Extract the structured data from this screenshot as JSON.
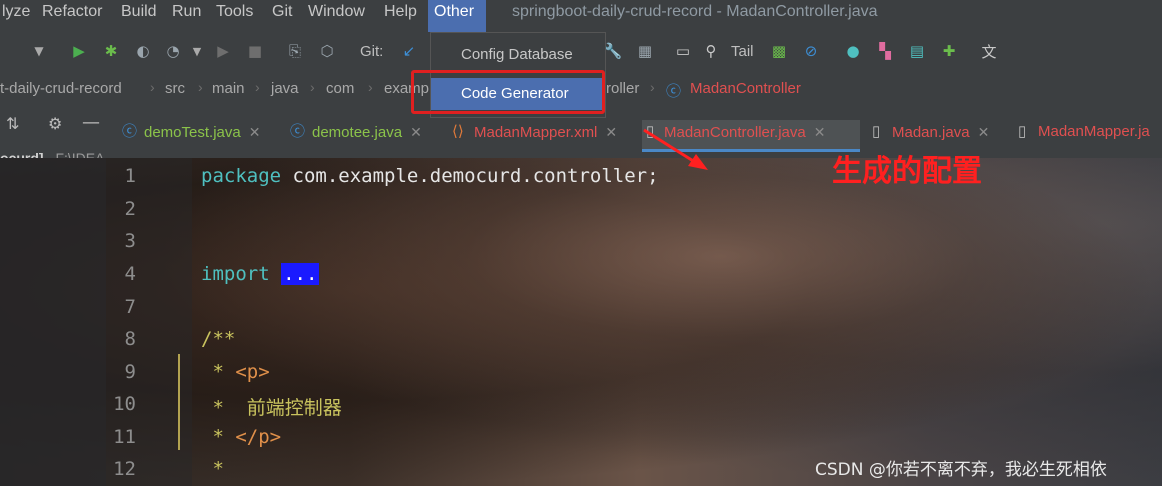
{
  "menubar": {
    "items": [
      "lyze",
      "Refactor",
      "Build",
      "Run",
      "Tools",
      "Git",
      "Window",
      "Help",
      "Other"
    ],
    "title": "springboot-daily-crud-record - MadanController.java"
  },
  "toolbar": {
    "git_label": "Git:",
    "tail_label": "Tail"
  },
  "dropdown": {
    "items": [
      "Config Database",
      "Code Generator"
    ],
    "selected": "Code Generator"
  },
  "breadcrumb": {
    "items": [
      "t-daily-crud-record",
      "src",
      "main",
      "java",
      "com",
      "examp",
      "roller",
      "MadanController"
    ]
  },
  "tabs": [
    {
      "label": "demoTest.java",
      "color": "#8bc34a"
    },
    {
      "label": "demotee.java",
      "color": "#8bc34a"
    },
    {
      "label": "MadanMapper.xml",
      "color": "#e05050"
    },
    {
      "label": "MadanController.java",
      "color": "#e05050",
      "active": true
    },
    {
      "label": "Madan.java",
      "color": "#e05050"
    },
    {
      "label": "MadanMapper.ja",
      "color": "#e05050"
    }
  ],
  "project": {
    "label": "ocurd]",
    "path": "F:\\IDEA_"
  },
  "editor": {
    "line_numbers": [
      "1",
      "2",
      "3",
      "4",
      "7",
      "8",
      "9",
      "10",
      "11",
      "12"
    ],
    "code": {
      "l1_kw": "package",
      "l1_rest": " com.example.democurd.controller;",
      "l4_kw": "import",
      "l4_fold": "...",
      "l8": "/**",
      "l9_star": " * ",
      "l9_tag": "<p>",
      "l10": " *  前端控制器",
      "l11_star": " * ",
      "l11_tag": "</p>",
      "l12": " *"
    }
  },
  "annotation": "生成的配置",
  "watermark": "CSDN @你若不离不弃，我必生死相依",
  "colors": {
    "menu_bg": "#3c3f41",
    "selection": "#4b6eaf",
    "annotation_red": "#ff2020",
    "keyword": "#4fc0c0",
    "comment": "#c9c35e"
  }
}
